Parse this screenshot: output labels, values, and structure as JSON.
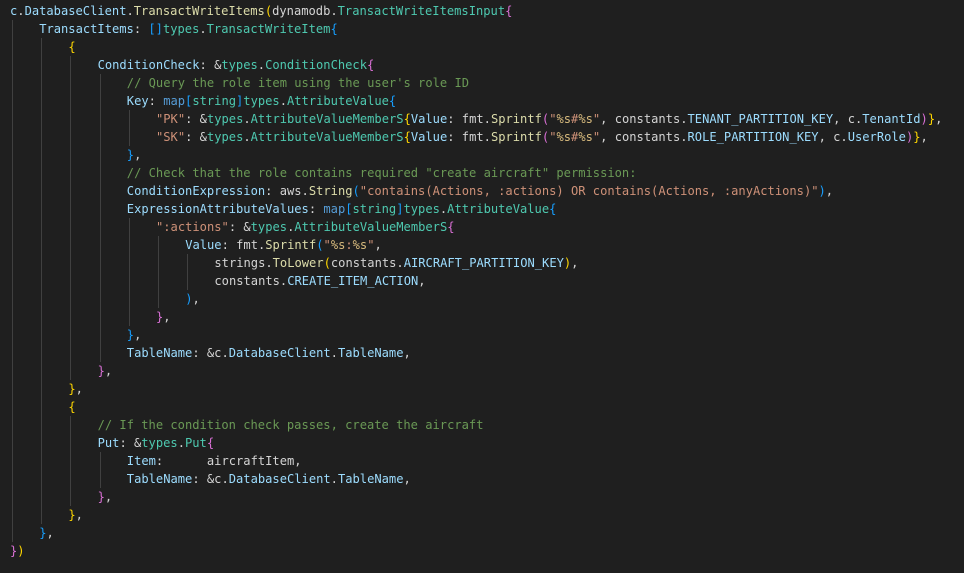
{
  "theme": {
    "background": "#1f1f1f",
    "guide": "#404040",
    "colors": {
      "var": "#9cdcfe",
      "fn": "#dcdcaa",
      "type": "#4ec9b0",
      "str": "#ce9178",
      "esc": "#d7ba7d",
      "comment": "#6a9955",
      "kw": "#569cd6",
      "plain": "#d4d4d4",
      "b1": "#ffd700",
      "b2": "#da70d6",
      "b3": "#179fff"
    }
  },
  "editor": {
    "lines": [
      {
        "indent": 0,
        "tokens": [
          [
            "var",
            "c"
          ],
          [
            "plain",
            "."
          ],
          [
            "var",
            "DatabaseClient"
          ],
          [
            "plain",
            "."
          ],
          [
            "fn",
            "TransactWriteItems"
          ],
          [
            "b1",
            "("
          ],
          [
            "plain",
            "dynamodb."
          ],
          [
            "type",
            "TransactWriteItemsInput"
          ],
          [
            "b2",
            "{"
          ]
        ]
      },
      {
        "indent": 1,
        "tokens": [
          [
            "var",
            "TransactItems"
          ],
          [
            "plain",
            ": "
          ],
          [
            "b3",
            "[]"
          ],
          [
            "type",
            "types"
          ],
          [
            "plain",
            "."
          ],
          [
            "type",
            "TransactWriteItem"
          ],
          [
            "b3",
            "{"
          ]
        ]
      },
      {
        "indent": 2,
        "tokens": [
          [
            "b1",
            "{"
          ]
        ]
      },
      {
        "indent": 3,
        "tokens": [
          [
            "var",
            "ConditionCheck"
          ],
          [
            "plain",
            ": &"
          ],
          [
            "type",
            "types"
          ],
          [
            "plain",
            "."
          ],
          [
            "type",
            "ConditionCheck"
          ],
          [
            "b2",
            "{"
          ]
        ]
      },
      {
        "indent": 4,
        "tokens": [
          [
            "comment",
            "// Query the role item using the user's role ID"
          ]
        ]
      },
      {
        "indent": 4,
        "tokens": [
          [
            "var",
            "Key"
          ],
          [
            "plain",
            ": "
          ],
          [
            "kw",
            "map"
          ],
          [
            "b3",
            "["
          ],
          [
            "type",
            "string"
          ],
          [
            "b3",
            "]"
          ],
          [
            "type",
            "types"
          ],
          [
            "plain",
            "."
          ],
          [
            "type",
            "AttributeValue"
          ],
          [
            "b3",
            "{"
          ]
        ]
      },
      {
        "indent": 5,
        "tokens": [
          [
            "str",
            "\"PK\""
          ],
          [
            "plain",
            ": &"
          ],
          [
            "type",
            "types"
          ],
          [
            "plain",
            "."
          ],
          [
            "type",
            "AttributeValueMemberS"
          ],
          [
            "b1",
            "{"
          ],
          [
            "var",
            "Value"
          ],
          [
            "plain",
            ": fmt."
          ],
          [
            "fn",
            "Sprintf"
          ],
          [
            "b2",
            "("
          ],
          [
            "str",
            "\""
          ],
          [
            "esc",
            "%s"
          ],
          [
            "str",
            "#"
          ],
          [
            "esc",
            "%s"
          ],
          [
            "str",
            "\""
          ],
          [
            "plain",
            ", constants."
          ],
          [
            "var",
            "TENANT_PARTITION_KEY"
          ],
          [
            "plain",
            ", c."
          ],
          [
            "var",
            "TenantId"
          ],
          [
            "b2",
            ")"
          ],
          [
            "b1",
            "}"
          ],
          [
            "plain",
            ","
          ]
        ]
      },
      {
        "indent": 5,
        "tokens": [
          [
            "str",
            "\"SK\""
          ],
          [
            "plain",
            ": &"
          ],
          [
            "type",
            "types"
          ],
          [
            "plain",
            "."
          ],
          [
            "type",
            "AttributeValueMemberS"
          ],
          [
            "b1",
            "{"
          ],
          [
            "var",
            "Value"
          ],
          [
            "plain",
            ": fmt."
          ],
          [
            "fn",
            "Sprintf"
          ],
          [
            "b2",
            "("
          ],
          [
            "str",
            "\""
          ],
          [
            "esc",
            "%s"
          ],
          [
            "str",
            "#"
          ],
          [
            "esc",
            "%s"
          ],
          [
            "str",
            "\""
          ],
          [
            "plain",
            ", constants."
          ],
          [
            "var",
            "ROLE_PARTITION_KEY"
          ],
          [
            "plain",
            ", c."
          ],
          [
            "var",
            "UserRole"
          ],
          [
            "b2",
            ")"
          ],
          [
            "b1",
            "}"
          ],
          [
            "plain",
            ","
          ]
        ]
      },
      {
        "indent": 4,
        "tokens": [
          [
            "b3",
            "}"
          ],
          [
            "plain",
            ","
          ]
        ]
      },
      {
        "indent": 4,
        "tokens": [
          [
            "comment",
            "// Check that the role contains required \"create aircraft\" permission:"
          ]
        ]
      },
      {
        "indent": 4,
        "tokens": [
          [
            "var",
            "ConditionExpression"
          ],
          [
            "plain",
            ": aws."
          ],
          [
            "fn",
            "String"
          ],
          [
            "b3",
            "("
          ],
          [
            "str",
            "\"contains(Actions, :actions) OR contains(Actions, :anyActions)\""
          ],
          [
            "b3",
            ")"
          ],
          [
            "plain",
            ","
          ]
        ]
      },
      {
        "indent": 4,
        "tokens": [
          [
            "var",
            "ExpressionAttributeValues"
          ],
          [
            "plain",
            ": "
          ],
          [
            "kw",
            "map"
          ],
          [
            "b3",
            "["
          ],
          [
            "type",
            "string"
          ],
          [
            "b3",
            "]"
          ],
          [
            "type",
            "types"
          ],
          [
            "plain",
            "."
          ],
          [
            "type",
            "AttributeValue"
          ],
          [
            "b3",
            "{"
          ]
        ]
      },
      {
        "indent": 5,
        "tokens": [
          [
            "str",
            "\":actions\""
          ],
          [
            "plain",
            ": &"
          ],
          [
            "type",
            "types"
          ],
          [
            "plain",
            "."
          ],
          [
            "type",
            "AttributeValueMemberS"
          ],
          [
            "b2",
            "{"
          ]
        ]
      },
      {
        "indent": 6,
        "tokens": [
          [
            "var",
            "Value"
          ],
          [
            "plain",
            ": fmt."
          ],
          [
            "fn",
            "Sprintf"
          ],
          [
            "b3",
            "("
          ],
          [
            "str",
            "\""
          ],
          [
            "esc",
            "%s"
          ],
          [
            "str",
            ":"
          ],
          [
            "esc",
            "%s"
          ],
          [
            "str",
            "\""
          ],
          [
            "plain",
            ","
          ]
        ]
      },
      {
        "indent": 7,
        "tokens": [
          [
            "plain",
            "strings."
          ],
          [
            "fn",
            "ToLower"
          ],
          [
            "b1",
            "("
          ],
          [
            "plain",
            "constants."
          ],
          [
            "var",
            "AIRCRAFT_PARTITION_KEY"
          ],
          [
            "b1",
            ")"
          ],
          [
            "plain",
            ","
          ]
        ]
      },
      {
        "indent": 7,
        "tokens": [
          [
            "plain",
            "constants."
          ],
          [
            "var",
            "CREATE_ITEM_ACTION"
          ],
          [
            "plain",
            ","
          ]
        ]
      },
      {
        "indent": 6,
        "tokens": [
          [
            "b3",
            ")"
          ],
          [
            "plain",
            ","
          ]
        ]
      },
      {
        "indent": 5,
        "tokens": [
          [
            "b2",
            "}"
          ],
          [
            "plain",
            ","
          ]
        ]
      },
      {
        "indent": 4,
        "tokens": [
          [
            "b3",
            "}"
          ],
          [
            "plain",
            ","
          ]
        ]
      },
      {
        "indent": 4,
        "tokens": [
          [
            "var",
            "TableName"
          ],
          [
            "plain",
            ": &c."
          ],
          [
            "var",
            "DatabaseClient"
          ],
          [
            "plain",
            "."
          ],
          [
            "var",
            "TableName"
          ],
          [
            "plain",
            ","
          ]
        ]
      },
      {
        "indent": 3,
        "tokens": [
          [
            "b2",
            "}"
          ],
          [
            "plain",
            ","
          ]
        ]
      },
      {
        "indent": 2,
        "tokens": [
          [
            "b1",
            "}"
          ],
          [
            "plain",
            ","
          ]
        ]
      },
      {
        "indent": 2,
        "tokens": [
          [
            "b1",
            "{"
          ]
        ]
      },
      {
        "indent": 3,
        "tokens": [
          [
            "comment",
            "// If the condition check passes, create the aircraft"
          ]
        ]
      },
      {
        "indent": 3,
        "tokens": [
          [
            "var",
            "Put"
          ],
          [
            "plain",
            ": &"
          ],
          [
            "type",
            "types"
          ],
          [
            "plain",
            "."
          ],
          [
            "type",
            "Put"
          ],
          [
            "b2",
            "{"
          ]
        ]
      },
      {
        "indent": 4,
        "tokens": [
          [
            "var",
            "Item"
          ],
          [
            "plain",
            ":      aircraftItem,"
          ]
        ]
      },
      {
        "indent": 4,
        "tokens": [
          [
            "var",
            "TableName"
          ],
          [
            "plain",
            ": &c."
          ],
          [
            "var",
            "DatabaseClient"
          ],
          [
            "plain",
            "."
          ],
          [
            "var",
            "TableName"
          ],
          [
            "plain",
            ","
          ]
        ]
      },
      {
        "indent": 3,
        "tokens": [
          [
            "b2",
            "}"
          ],
          [
            "plain",
            ","
          ]
        ]
      },
      {
        "indent": 2,
        "tokens": [
          [
            "b1",
            "}"
          ],
          [
            "plain",
            ","
          ]
        ]
      },
      {
        "indent": 1,
        "tokens": [
          [
            "b3",
            "}"
          ],
          [
            "plain",
            ","
          ]
        ]
      },
      {
        "indent": 0,
        "tokens": [
          [
            "b2",
            "}"
          ],
          [
            "b1",
            ")"
          ]
        ]
      }
    ]
  }
}
